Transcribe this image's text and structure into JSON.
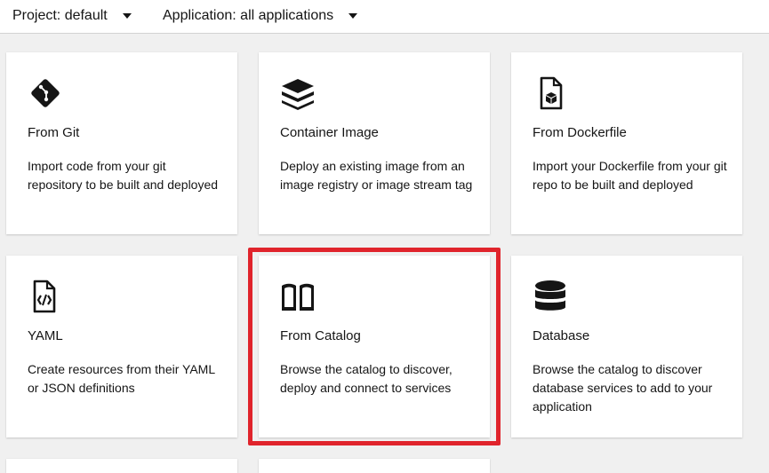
{
  "toolbar": {
    "project_label": "Project: default",
    "application_label": "Application: all applications"
  },
  "cards": [
    {
      "title": "From Git",
      "description": "Import code from your git repository to be built and deployed",
      "icon": "git-icon"
    },
    {
      "title": "Container Image",
      "description": "Deploy an existing image from an image registry or image stream tag",
      "icon": "layers-icon"
    },
    {
      "title": "From Dockerfile",
      "description": "Import your Dockerfile from your git repo to be built and deployed",
      "icon": "dockerfile-icon"
    },
    {
      "title": "YAML",
      "description": "Create resources from their YAML or JSON definitions",
      "icon": "yaml-file-icon"
    },
    {
      "title": "From Catalog",
      "description": "Browse the catalog to discover, deploy and connect to services",
      "icon": "book-icon"
    },
    {
      "title": "Database",
      "description": "Browse the catalog to discover database services to add to your application",
      "icon": "database-icon"
    }
  ],
  "highlight_color": "#e0242c"
}
